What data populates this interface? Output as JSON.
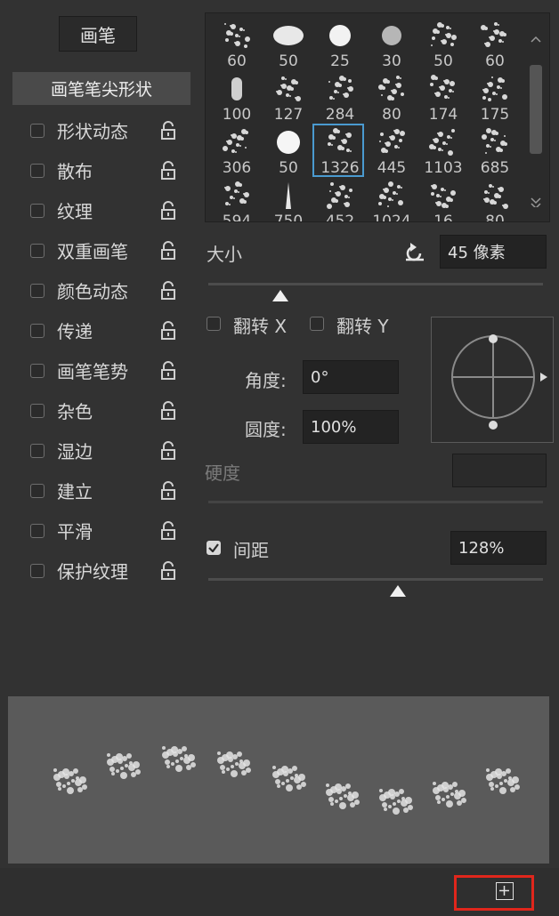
{
  "left": {
    "brushes_button": "画笔",
    "tip_shape": "画笔笔尖形状",
    "options": [
      {
        "label": "形状动态"
      },
      {
        "label": "散布"
      },
      {
        "label": "纹理"
      },
      {
        "label": "双重画笔"
      },
      {
        "label": "颜色动态"
      },
      {
        "label": "传递"
      },
      {
        "label": "画笔笔势"
      },
      {
        "label": "杂色"
      },
      {
        "label": "湿边"
      },
      {
        "label": "建立"
      },
      {
        "label": "平滑"
      },
      {
        "label": "保护纹理"
      }
    ]
  },
  "grid": {
    "rows": [
      [
        "60",
        "50",
        "25",
        "30",
        "50",
        "60"
      ],
      [
        "100",
        "127",
        "284",
        "80",
        "174",
        "175"
      ],
      [
        "306",
        "50",
        "1326",
        "445",
        "1103",
        "685"
      ],
      [
        "594",
        "750",
        "452",
        "1024",
        "16",
        "80"
      ]
    ],
    "selected": "1326",
    "scroll_up_icon": "chevron-up-icon",
    "scroll_down_icon": "chevron-down-icon"
  },
  "size": {
    "label": "大小",
    "value": "45 像素",
    "reset_icon": "reset-icon"
  },
  "flip": {
    "x": "翻转 X",
    "y": "翻转 Y"
  },
  "angle": {
    "label": "角度:",
    "value": "0°"
  },
  "roundness": {
    "label": "圆度:",
    "value": "100%"
  },
  "hardness": {
    "label": "硬度",
    "value": ""
  },
  "spacing": {
    "label": "间距",
    "value": "128%",
    "checked": true
  },
  "colors": {
    "accent": "#4a9ad0",
    "highlight": "#e0261c"
  }
}
